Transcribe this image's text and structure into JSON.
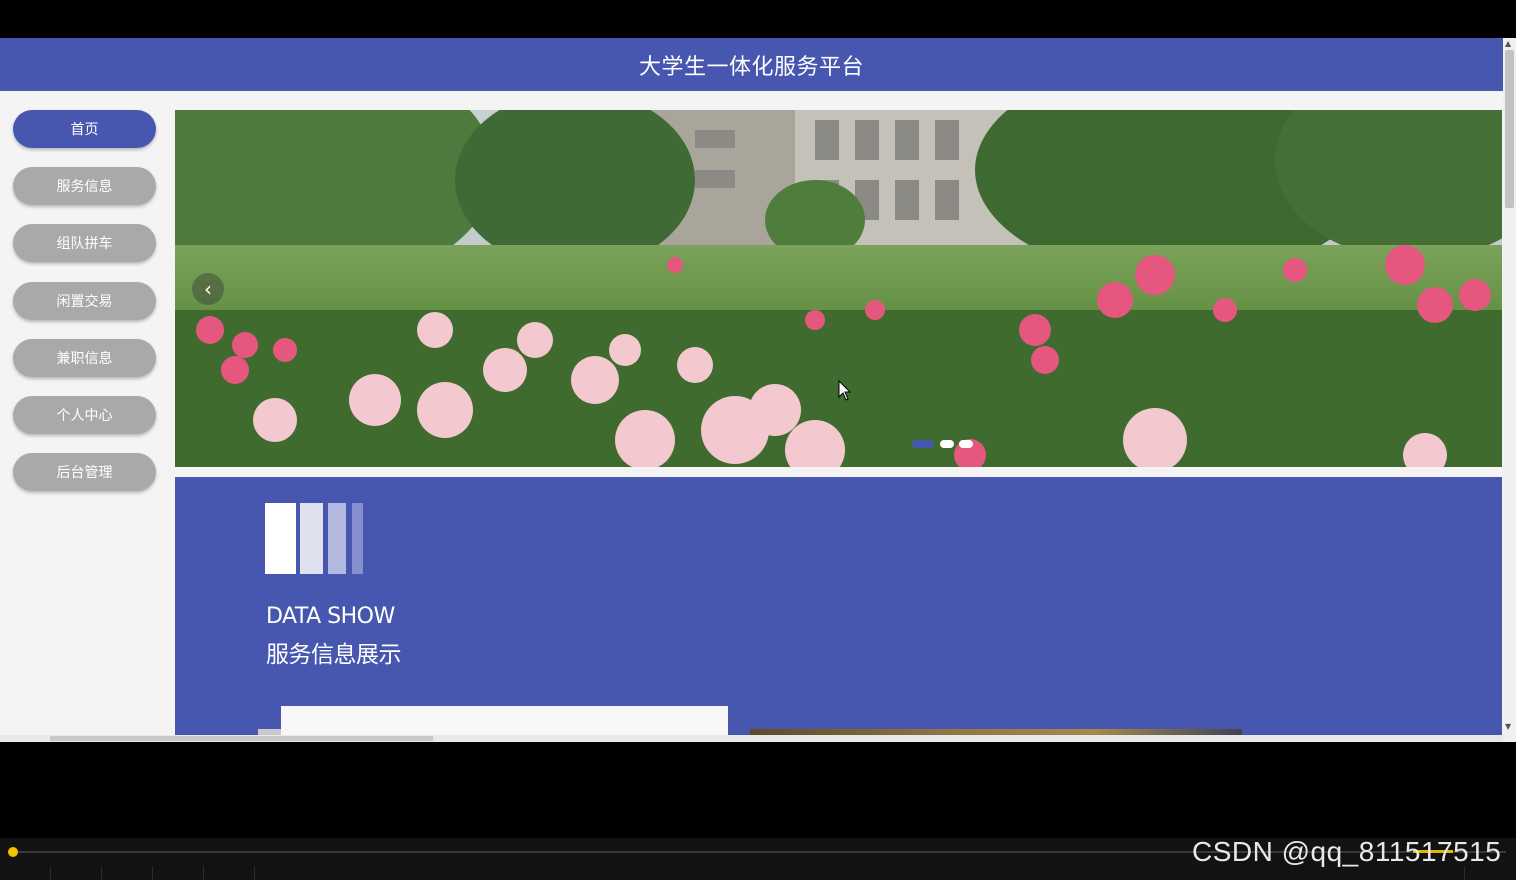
{
  "header": {
    "title": "大学生一体化服务平台"
  },
  "sidebar": {
    "items": [
      {
        "label": "首页",
        "active": true
      },
      {
        "label": "服务信息",
        "active": false
      },
      {
        "label": "组队拼车",
        "active": false
      },
      {
        "label": "闲置交易",
        "active": false
      },
      {
        "label": "兼职信息",
        "active": false
      },
      {
        "label": "个人中心",
        "active": false
      },
      {
        "label": "后台管理",
        "active": false
      }
    ]
  },
  "banner": {
    "prev_icon": "chevron-left-icon",
    "slide_count": 3,
    "active_slide": 1
  },
  "data_show": {
    "title": "DATA SHOW",
    "subtitle": "服务信息展示"
  },
  "watermark": {
    "text": "CSDN @qq_811517515"
  },
  "colors": {
    "primary": "#4757b0",
    "nav_inactive": "#a9a9a9",
    "accent_yellow": "#f2c100"
  }
}
